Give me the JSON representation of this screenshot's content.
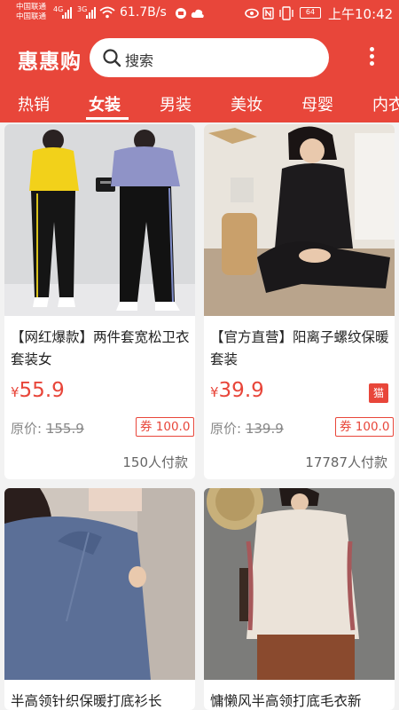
{
  "status_bar": {
    "carrier_1": "中国联通",
    "carrier_2": "中国联通",
    "net_1": "4G",
    "net_2": "3G",
    "speed": "61.7B/s",
    "battery": "64",
    "time": "上午10:42"
  },
  "header": {
    "brand": "惠惠购",
    "search_placeholder": "搜索"
  },
  "tabs": [
    {
      "label": "热销"
    },
    {
      "label": "女装"
    },
    {
      "label": "男装"
    },
    {
      "label": "美妆"
    },
    {
      "label": "母婴"
    },
    {
      "label": "内衣"
    }
  ],
  "active_tab": "女装",
  "products": [
    {
      "title": "【网红爆款】两件套宽松卫衣套装女",
      "currency": "¥",
      "price": "55.9",
      "original_label": "原价:",
      "original_price": "155.9",
      "coupon": "券 100.0",
      "sold": "150人付款"
    },
    {
      "title": "【官方直营】阳离子螺纹保暖套装",
      "currency": "¥",
      "price": "39.9",
      "badge": "猫",
      "original_label": "原价:",
      "original_price": "139.9",
      "coupon": "券 100.0",
      "sold": "17787人付款"
    },
    {
      "title": "半高领针织保暖打底衫长"
    },
    {
      "title": "慵懒风半高领打底毛衣新"
    }
  ],
  "colors": {
    "accent": "#e8463a",
    "background": "#f2f2f2"
  }
}
